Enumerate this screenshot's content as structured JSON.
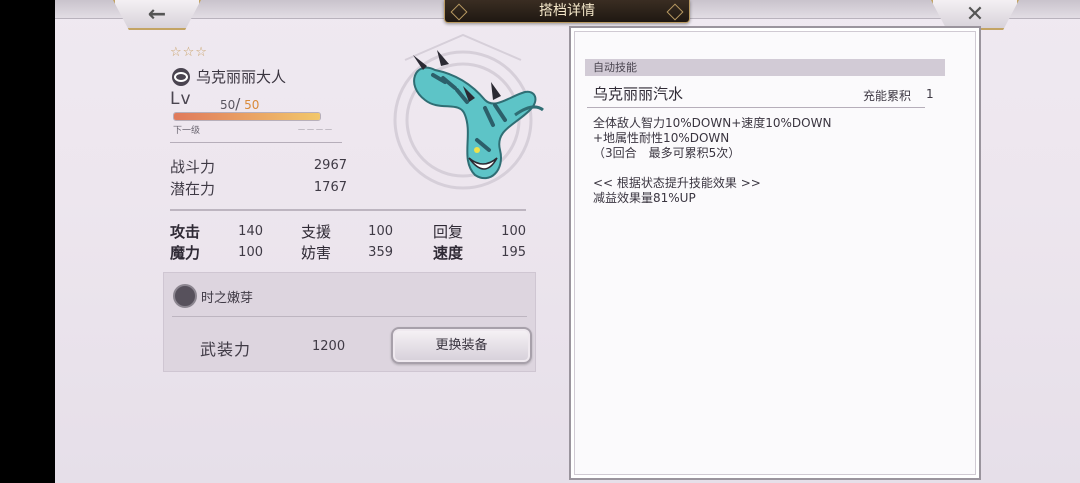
{
  "header": {
    "title": "搭档详情",
    "back_icon": "←",
    "close_icon": "✕"
  },
  "character": {
    "stars": "☆☆☆",
    "name": "乌克丽丽大人",
    "lv_label": "Lv",
    "level": "50",
    "level_max": "50",
    "exp_progress": 1.0,
    "next_label": "下一级",
    "next_value": "－－－－"
  },
  "stats": {
    "combat_label": "战斗力",
    "combat_value": "2967",
    "potential_label": "潜在力",
    "potential_value": "1767"
  },
  "attributes": [
    {
      "label": "攻击",
      "value": "140",
      "bold": true
    },
    {
      "label": "支援",
      "value": "100",
      "bold": false
    },
    {
      "label": "回复",
      "value": "100",
      "bold": false
    },
    {
      "label": "魔力",
      "value": "100",
      "bold": true
    },
    {
      "label": "妨害",
      "value": "359",
      "bold": false
    },
    {
      "label": "速度",
      "value": "195",
      "bold": true
    }
  ],
  "equipment": {
    "name": "时之嫩芽",
    "armament_label": "武装力",
    "armament_value": "1200",
    "change_button": "更换装备"
  },
  "skill": {
    "tag": "自动技能",
    "name": "乌克丽丽汽水",
    "charge_label": "充能累积",
    "charge_value": "1",
    "description": "全体敌人智力10%DOWN+速度10%DOWN\n+地属性耐性10%DOWN\n（3回合　最多可累积5次）",
    "bonus_header": "<< 根据状态提升技能效果 >>",
    "bonus_desc": "减益效果量81%UP"
  }
}
